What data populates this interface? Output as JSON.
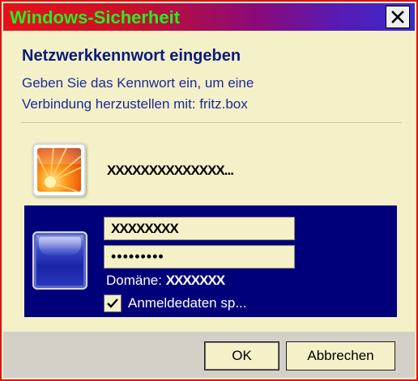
{
  "window": {
    "title": "Windows-Sicherheit",
    "close_icon": "close-icon"
  },
  "dialog": {
    "heading": "Netzwerkkennwort eingeben",
    "description_line1": "Geben Sie das Kennwort ein, um eine",
    "description_line2": "Verbindung herzustellen mit: fritz.box"
  },
  "saved_credential": {
    "icon": "flower-user-icon",
    "name": "XXXXXXXXXXXXXX..."
  },
  "credential_entry": {
    "icon": "user-tile-icon",
    "username_value": "XXXXXXXX",
    "password_value": "•••••••••",
    "domain_label": "Domäne:",
    "domain_value": "XXXXXXX",
    "remember_label": "Anmeldedaten sp...",
    "remember_checked": true
  },
  "buttons": {
    "ok": "OK",
    "cancel": "Abbrechen"
  },
  "colors": {
    "title_text": "#22f022",
    "heading": "#0a1c7a",
    "selected_tile": "#00007a",
    "window_border": "#e01010"
  }
}
